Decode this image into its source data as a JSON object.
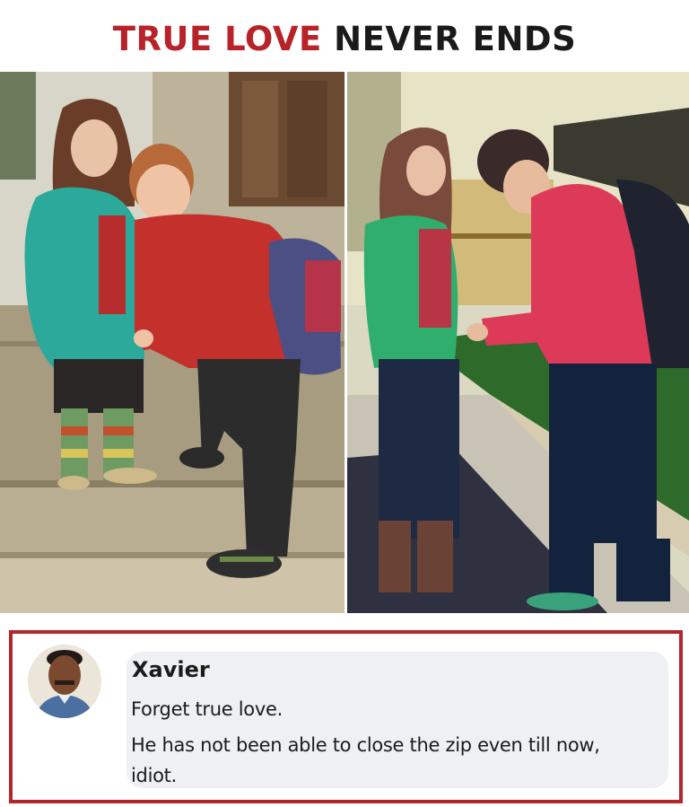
{
  "header": {
    "title_part1": "TRUE LOVE",
    "title_part2": "NEVER ENDS",
    "title_part1_color": "#b8232a",
    "title_part2_color": "#1a1a1a"
  },
  "photos": {
    "left_description_icon": "photo-kids",
    "right_description_icon": "photo-teens"
  },
  "comment": {
    "author": "Xavier",
    "lines": [
      "Forget true love.",
      "He has not been able to close the zip even till now,",
      "idiot."
    ],
    "border_color": "#b3262c",
    "bubble_color": "#eef0f3"
  }
}
